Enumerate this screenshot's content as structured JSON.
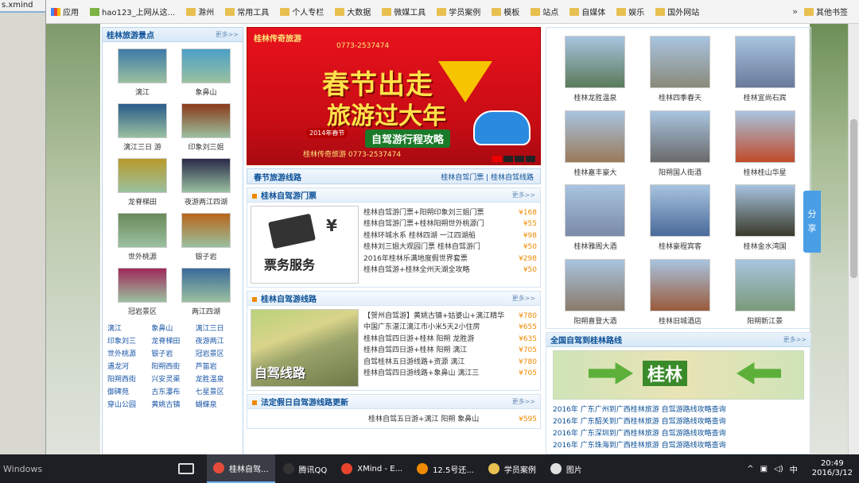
{
  "left_window": {
    "title": "s.xmind"
  },
  "bookmarks": [
    {
      "label": "应用",
      "icon": "apps-icon"
    },
    {
      "label": "hao123_上网从这...",
      "icon": "site-icon"
    },
    {
      "label": "滁州",
      "icon": "folder-icon"
    },
    {
      "label": "常用工具",
      "icon": "folder-icon"
    },
    {
      "label": "个人专栏",
      "icon": "folder-icon"
    },
    {
      "label": "大数据",
      "icon": "folder-icon"
    },
    {
      "label": "微媒工具",
      "icon": "folder-icon"
    },
    {
      "label": "学员案例",
      "icon": "folder-icon"
    },
    {
      "label": "模板",
      "icon": "folder-icon"
    },
    {
      "label": "站点",
      "icon": "folder-icon"
    },
    {
      "label": "自媒体",
      "icon": "folder-icon"
    },
    {
      "label": "娱乐",
      "icon": "folder-icon"
    },
    {
      "label": "国外网站",
      "icon": "folder-icon"
    }
  ],
  "bookmarks_more": "»",
  "bookmarks_other": "其他书签",
  "left_col": {
    "title": "桂林旅游景点",
    "more": "更多>>",
    "spots": [
      {
        "label": "漓江",
        "color": "#3d7aa8"
      },
      {
        "label": "象鼻山",
        "color": "#4aa0c8"
      },
      {
        "label": "漓江三日 游",
        "color": "#2a5c8a"
      },
      {
        "label": "印象刘三姐",
        "color": "#8a3a1a"
      },
      {
        "label": "龙脊梯田",
        "color": "#b89a2a"
      },
      {
        "label": "夜游两江四湖",
        "color": "#2a2a4a"
      },
      {
        "label": "世外桃源",
        "color": "#6a8a5a"
      },
      {
        "label": "银子岩",
        "color": "#b8651a"
      },
      {
        "label": "冠岩景区",
        "color": "#a02a5a"
      },
      {
        "label": "两江四湖",
        "color": "#3a6a9a"
      }
    ],
    "cities": [
      "漓江",
      "象鼻山",
      "漓江三日",
      "印象刘三",
      "龙脊梯田",
      "夜游两江",
      "世外桃源",
      "银子岩",
      "冠岩景区",
      "遇龙河",
      "阳朔西街",
      "芦笛岩",
      "阳朔西街",
      "兴安灵渠",
      "龙胜温泉",
      "御碑苑",
      "古东瀑布",
      "七星景区",
      "穿山公园",
      "黄姚古镇",
      "蝴蝶泉"
    ]
  },
  "banner": {
    "brand": "桂林传奇旅游",
    "tel": "0773-2537474",
    "line1": "春节出走",
    "line2": "旅游过大年",
    "tag": "2014年春节",
    "badge": "自驾游行程攻略",
    "foot": "桂林传奇旅游 0773-2537474"
  },
  "mid": {
    "bar_title": "春节旅游线路",
    "bar_links": "桂林自驾门票 | 桂林自驾线路",
    "tickets": {
      "title": "桂林自驾游门票",
      "more": "更多>>",
      "img_text": "票务服务",
      "rows": [
        {
          "n": "桂林自驾游门票+阳朔印象刘三姐门票",
          "p": "¥168"
        },
        {
          "n": "桂林自驾游门票+桂林阳朔世外桃源门",
          "p": "¥55"
        },
        {
          "n": "桂林环城水系 桂林四湖 一江四湖船",
          "p": "¥98"
        },
        {
          "n": "桂林刘三姐大观园门票 桂林自驾游门",
          "p": "¥50"
        },
        {
          "n": "2016年桂林乐满地度假世界套票",
          "p": "¥298"
        },
        {
          "n": "桂林自驾游+桂林全州天湖全攻略",
          "p": "¥50"
        }
      ]
    },
    "routes": {
      "title": "桂林自驾游线路",
      "more": "更多>>",
      "img_text": "自驾线路",
      "rows": [
        {
          "n": "【贺州自驾游】黄姚古镇+姑婆山+漓江精华",
          "p": "¥780"
        },
        {
          "n": "中国广东湛江漓江市小米5天2小住房",
          "p": "¥655"
        },
        {
          "n": "桂林自驾四日游+桂林 阳朔 龙胜游",
          "p": "¥635"
        },
        {
          "n": "桂林自驾四日游+桂林 阳朔 漓江",
          "p": "¥705"
        },
        {
          "n": "自驾桂林五日游线路+资源 漓江",
          "p": "¥780"
        },
        {
          "n": "桂林自驾四日游线路+象鼻山 漓江三",
          "p": "¥705"
        }
      ]
    },
    "holiday": {
      "title": "法定假日自驾游线路更新",
      "more": "更多>>",
      "rows": [
        {
          "n": "桂林自驾五日游+漓江 阳朔 象鼻山",
          "p": "¥595"
        }
      ]
    }
  },
  "right": {
    "hotels": [
      {
        "label": "桂林龙胜温泉",
        "color": "#5a7a5a"
      },
      {
        "label": "桂林四季春天",
        "color": "#8a8a7a"
      },
      {
        "label": "桂林宜尚石宾",
        "color": "#6a7a9a"
      },
      {
        "label": "桂林嘉丰豪大",
        "color": "#9a7a5a"
      },
      {
        "label": "阳朔国人街酒",
        "color": "#6a6a6a"
      },
      {
        "label": "桂林桂山华星",
        "color": "#c04a2a"
      },
      {
        "label": "桂林雅阁大酒",
        "color": "#7a8aa8"
      },
      {
        "label": "桂林豪程宾客",
        "color": "#4a6a9a"
      },
      {
        "label": "桂林金水湾国",
        "color": "#3a3a2a"
      },
      {
        "label": "阳朔喜登大酒",
        "color": "#8a7a6a"
      },
      {
        "label": "桂林旧城酒店",
        "color": "#9a5a3a"
      },
      {
        "label": "阳朔新江景",
        "color": "#7a9a7a"
      }
    ],
    "route_box": {
      "title": "全国自驾到桂林路线",
      "more": "更多>>",
      "map_city": "桂林",
      "rows": [
        "2016年 广东广州到广西桂林旅游 自驾游路线攻略查询",
        "2016年 广东韶关到广西桂林旅游 自驾游路线攻略查询",
        "2016年 广东深圳到广西桂林旅游 自驾游路线攻略查询",
        "2016年 广东珠海到广西桂林旅游 自驾游路线攻略查询"
      ]
    }
  },
  "share": {
    "line1": "分",
    "line2": "享"
  },
  "taskbar": {
    "windows_label": "Windows",
    "tasks": [
      {
        "label": "桂林自驾...",
        "color": "#e54b3a",
        "active": true
      },
      {
        "label": "腾讯QQ",
        "color": "#333333",
        "active": false
      },
      {
        "label": "XMind - E...",
        "color": "#e8432d",
        "active": false
      },
      {
        "label": "12.5号还...",
        "color": "#f08a00",
        "active": false
      },
      {
        "label": "学员案例",
        "color": "#e8c050",
        "active": false
      },
      {
        "label": "图片",
        "color": "#e0e0e0",
        "active": false
      }
    ],
    "ime": "中",
    "time": "20:49",
    "date": "2016/3/12"
  }
}
